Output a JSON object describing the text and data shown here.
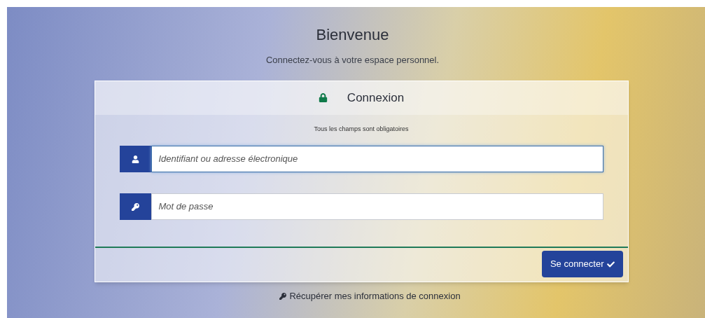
{
  "header": {
    "title": "Bienvenue",
    "subtitle": "Connectez-vous à votre espace personnel."
  },
  "form": {
    "title": "Connexion",
    "note": "Tous les champs sont obligatoires",
    "fields": [
      {
        "kind": "user",
        "placeholder": "Identifiant ou adresse électronique",
        "focused": true
      },
      {
        "kind": "password",
        "placeholder": "Mot de passe",
        "focused": false
      }
    ],
    "submit": "Se connecter"
  },
  "recover_link": "Récupérer mes informations de connexion"
}
